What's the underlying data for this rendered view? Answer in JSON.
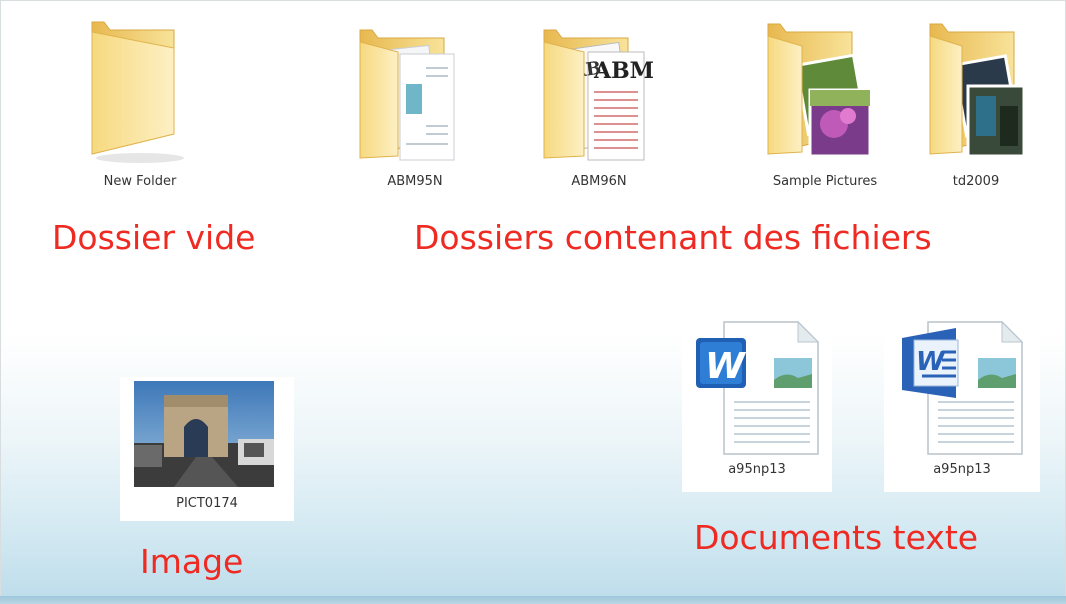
{
  "folders": [
    {
      "name": "New Folder"
    },
    {
      "name": "ABM95N"
    },
    {
      "name": "ABM96N"
    },
    {
      "name": "Sample Pictures"
    },
    {
      "name": "td2009"
    }
  ],
  "image_file": {
    "name": "PICT0174"
  },
  "documents": [
    {
      "name": "a95np13"
    },
    {
      "name": "a95np13"
    }
  ],
  "headings": {
    "empty_folder": "Dossier vide",
    "folders_with_files": "Dossiers contenant des fichiers",
    "image": "Image",
    "text_documents": "Documents texte"
  },
  "colors": {
    "heading": "#ee2a22",
    "folder": "#f3d57a",
    "word_blue": "#1f5fb4"
  }
}
